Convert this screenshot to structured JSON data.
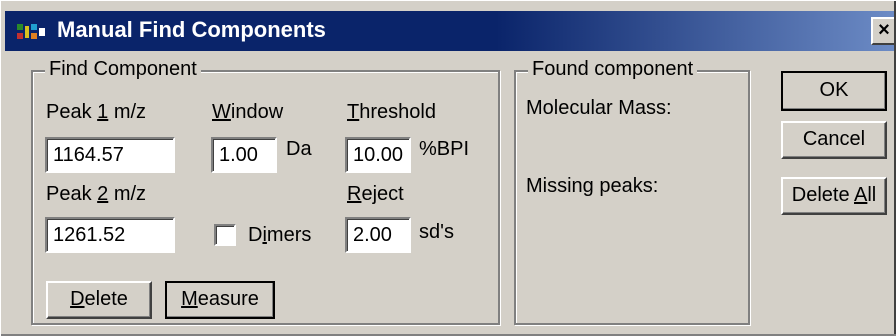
{
  "window": {
    "title": "Manual Find Components",
    "close_glyph": "×",
    "icon": "app-icon"
  },
  "find_component": {
    "legend": "Find Component",
    "peak1": {
      "label_pre": "Peak ",
      "label_accel": "1",
      "label_post": " m/z",
      "value": "1164.57"
    },
    "peak2": {
      "label_pre": "Peak ",
      "label_accel": "2",
      "label_post": " m/z",
      "value": "1261.52"
    },
    "window": {
      "label_accel": "W",
      "label_post": "indow",
      "value": "1.00",
      "unit": "Da"
    },
    "threshold": {
      "label_accel": "T",
      "label_post": "hreshold",
      "value": "10.00",
      "unit": "%BPI"
    },
    "reject": {
      "label_accel": "R",
      "label_post": "eject",
      "value": "2.00",
      "unit": "sd's"
    },
    "dimers": {
      "label_pre": "D",
      "label_accel": "i",
      "label_post": "mers",
      "checked": false
    },
    "delete_button": {
      "accel": "D",
      "rest": "elete"
    },
    "measure_button": {
      "accel": "M",
      "rest": "easure"
    }
  },
  "found_component": {
    "legend": "Found component",
    "molecular_mass_label": "Molecular Mass:",
    "missing_peaks_label": "Missing peaks:"
  },
  "buttons": {
    "ok_label": "OK",
    "cancel_label": "Cancel",
    "delete_all_pre": "Delete ",
    "delete_all_accel": "A",
    "delete_all_post": "ll"
  }
}
